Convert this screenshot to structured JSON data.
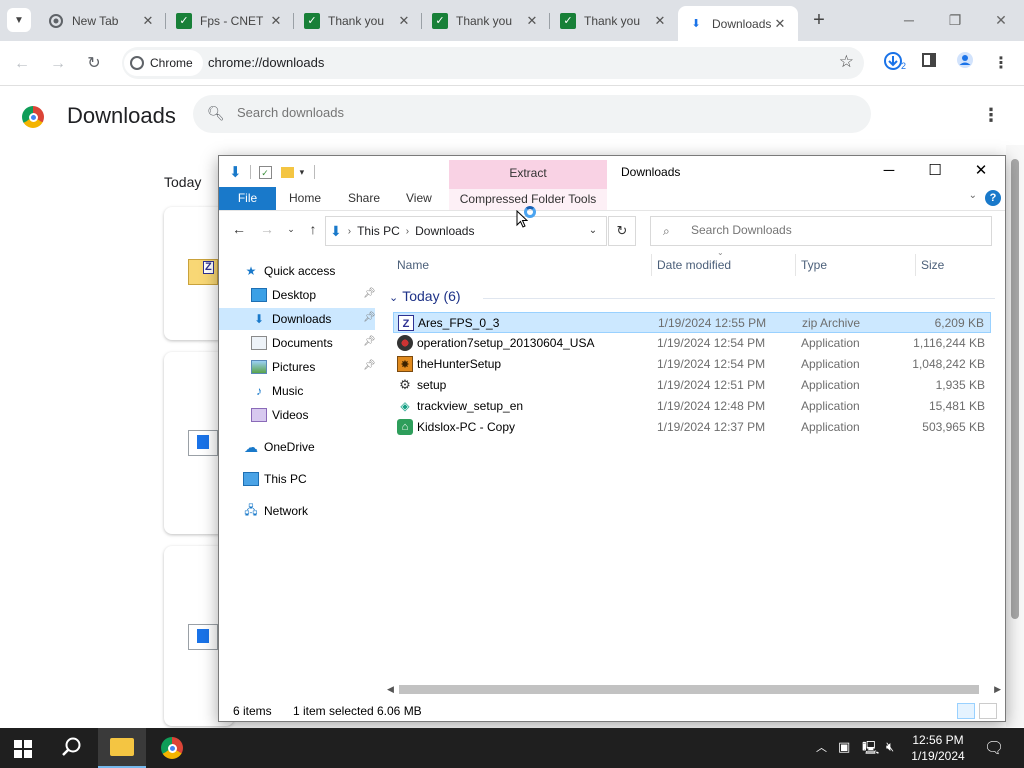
{
  "browser": {
    "tabs": [
      {
        "title": "New Tab",
        "favicon": "chrome-icon"
      },
      {
        "title": "Fps - CNET",
        "favicon": "v-icon"
      },
      {
        "title": "Thank you",
        "favicon": "v-icon"
      },
      {
        "title": "Thank you",
        "favicon": "v-icon"
      },
      {
        "title": "Thank you",
        "favicon": "v-icon"
      },
      {
        "title": "Downloads",
        "favicon": "download-icon",
        "active": true
      }
    ],
    "chip_label": "Chrome",
    "url": "chrome://downloads",
    "download_badge": "2"
  },
  "downloads_page": {
    "title": "Downloads",
    "search_placeholder": "Search downloads",
    "section": "Today"
  },
  "explorer": {
    "window_title": "Downloads",
    "context_tab_group": "Extract",
    "ribbon_tabs": [
      "File",
      "Home",
      "Share",
      "View",
      "Compressed Folder Tools"
    ],
    "breadcrumb": [
      "This PC",
      "Downloads"
    ],
    "search_placeholder": "Search Downloads",
    "nav": [
      {
        "label": "Quick access",
        "icon": "star-icon"
      },
      {
        "label": "Desktop",
        "icon": "desktop-icon",
        "pinned": true
      },
      {
        "label": "Downloads",
        "icon": "download-icon",
        "pinned": true,
        "selected": true
      },
      {
        "label": "Documents",
        "icon": "documents-icon",
        "pinned": true
      },
      {
        "label": "Pictures",
        "icon": "pictures-icon",
        "pinned": true
      },
      {
        "label": "Music",
        "icon": "music-icon"
      },
      {
        "label": "Videos",
        "icon": "videos-icon"
      },
      {
        "label": "OneDrive",
        "icon": "cloud-icon"
      },
      {
        "label": "This PC",
        "icon": "computer-icon"
      },
      {
        "label": "Network",
        "icon": "network-icon"
      }
    ],
    "columns": [
      "Name",
      "Date modified",
      "Type",
      "Size"
    ],
    "group_label": "Today (6)",
    "files": [
      {
        "name": "Ares_FPS_0_3",
        "date": "1/19/2024 12:55 PM",
        "type": "zip Archive",
        "size": "6,209 KB",
        "icon": "zip-icon",
        "selected": true
      },
      {
        "name": "operation7setup_20130604_USA",
        "date": "1/19/2024 12:54 PM",
        "type": "Application",
        "size": "1,116,244 KB",
        "icon": "app-icon"
      },
      {
        "name": "theHunterSetup",
        "date": "1/19/2024 12:54 PM",
        "type": "Application",
        "size": "1,048,242 KB",
        "icon": "app-icon"
      },
      {
        "name": "setup",
        "date": "1/19/2024 12:51 PM",
        "type": "Application",
        "size": "1,935 KB",
        "icon": "setup-icon"
      },
      {
        "name": "trackview_setup_en",
        "date": "1/19/2024 12:48 PM",
        "type": "Application",
        "size": "15,481 KB",
        "icon": "app-icon"
      },
      {
        "name": "Kidslox-PC - Copy",
        "date": "1/19/2024 12:37 PM",
        "type": "Application",
        "size": "503,965 KB",
        "icon": "app-icon"
      }
    ],
    "status": {
      "count": "6 items",
      "selection": "1 item selected",
      "size": "6.06 MB"
    }
  },
  "taskbar": {
    "time": "12:56 PM",
    "date": "1/19/2024"
  }
}
